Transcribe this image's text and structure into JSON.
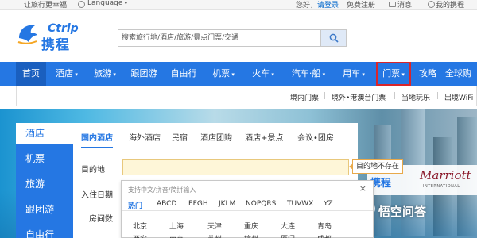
{
  "topbar": {
    "slogan": "让旅行更幸福",
    "language": "Language",
    "greeting": "您好，",
    "login": "请登录",
    "register": "免费注册",
    "messages": "消息",
    "my_orders": "我的携程"
  },
  "logo": {
    "en": "Ctrip",
    "cn": "携程"
  },
  "search": {
    "placeholder": "搜索旅行地/酒店/旅游/景点门票/交通"
  },
  "nav": [
    {
      "label": "首页",
      "caret": false
    },
    {
      "label": "酒店",
      "caret": true
    },
    {
      "label": "旅游",
      "caret": true
    },
    {
      "label": "跟团游",
      "caret": false
    },
    {
      "label": "自由行",
      "caret": false
    },
    {
      "label": "机票",
      "caret": true
    },
    {
      "label": "火车",
      "caret": true
    },
    {
      "label": "汽车·船",
      "caret": true
    },
    {
      "label": "用车",
      "caret": true
    },
    {
      "label": "门票",
      "caret": true
    },
    {
      "label": "攻略",
      "caret": false
    },
    {
      "label": "全球购",
      "caret": false
    }
  ],
  "subnav": [
    "境内门票",
    "境外•港澳台门票",
    "当地玩乐",
    "出境WiFi"
  ],
  "categories": [
    "酒店",
    "机票",
    "旅游",
    "跟团游",
    "自由行"
  ],
  "hotel_tabs": [
    "国内酒店",
    "海外酒店",
    "民宿",
    "酒店团购",
    "酒店+景点",
    "会议•团房"
  ],
  "form": {
    "destination_label": "目的地",
    "checkin_label": "入住日期",
    "rooms_label": "房间数",
    "destination_value": ""
  },
  "tooltip": "目的地不存在",
  "city_picker": {
    "hint": "支持中文/拼音/简拼输入",
    "close": "×",
    "tabs": [
      "热门",
      "ABCD",
      "EFGH",
      "JKLM",
      "NOPQRS",
      "TUVWX",
      "YZ"
    ],
    "cities_row1": [
      "北京",
      "上海",
      "天津",
      "重庆",
      "大连",
      "青岛"
    ],
    "cities_row2": [
      "西安",
      "南京",
      "苏州",
      "杭州",
      "厦门",
      "成都"
    ]
  },
  "banner": {
    "partner_ctrip": "携程",
    "partner_marriott": "Marriott",
    "partner_intl": "INTERNATIONAL",
    "watermark": "悟空问答"
  },
  "colors": {
    "brand_blue": "#2577e3",
    "highlight_red": "#d9252b",
    "input_warning_bg": "#fef6d8"
  }
}
